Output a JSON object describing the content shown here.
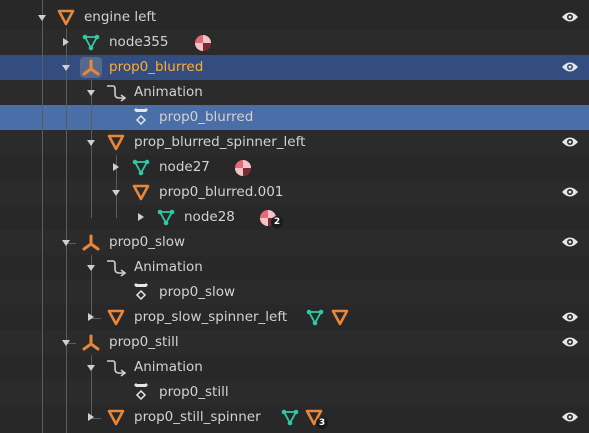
{
  "outliner": {
    "rows": [
      {
        "id": "r0",
        "label": "engine left",
        "visible": true
      },
      {
        "id": "r1",
        "label": "node355",
        "visible": false
      },
      {
        "id": "r2",
        "label": "prop0_blurred",
        "visible": true,
        "active": true
      },
      {
        "id": "r3",
        "label": "Animation",
        "visible": false
      },
      {
        "id": "r4",
        "label": "prop0_blurred",
        "visible": false,
        "selected": true
      },
      {
        "id": "r5",
        "label": "prop_blurred_spinner_left",
        "visible": true
      },
      {
        "id": "r6",
        "label": "node27",
        "visible": false
      },
      {
        "id": "r7",
        "label": "prop0_blurred.001",
        "visible": true
      },
      {
        "id": "r8",
        "label": "node28",
        "visible": false,
        "badge": "2"
      },
      {
        "id": "r9",
        "label": "prop0_slow",
        "visible": true
      },
      {
        "id": "r10",
        "label": "Animation",
        "visible": false
      },
      {
        "id": "r11",
        "label": "prop0_slow",
        "visible": false
      },
      {
        "id": "r12",
        "label": "prop_slow_spinner_left",
        "visible": true
      },
      {
        "id": "r13",
        "label": "prop0_still",
        "visible": true
      },
      {
        "id": "r14",
        "label": "Animation",
        "visible": false
      },
      {
        "id": "r15",
        "label": "prop0_still",
        "visible": false
      },
      {
        "id": "r16",
        "label": "prop0_still_spinner",
        "visible": true,
        "badge": "3"
      }
    ]
  },
  "colors": {
    "background": "#282828",
    "highlight_row": "#334d80",
    "selected_row": "#4a6ea7",
    "active_text": "#ffaf29",
    "empty_icon": "#e8873a",
    "mesh_icon": "#2ec9a6",
    "material_icon": "#e56a74"
  },
  "icons": {
    "empty": "empty-object-icon",
    "mesh": "mesh-data-icon",
    "material": "material-icon",
    "armature": "armature-bone-icon",
    "animation": "animation-curve-icon",
    "action": "action-keyframe-icon",
    "eye": "eye-visibility-icon"
  }
}
